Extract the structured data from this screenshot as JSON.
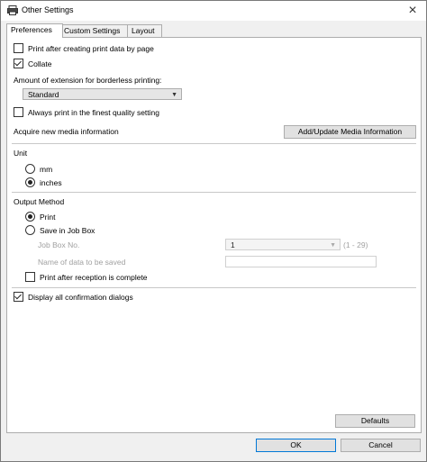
{
  "window": {
    "title": "Other Settings",
    "close_glyph": "×"
  },
  "tabs": [
    {
      "label": "Preferences",
      "active": true
    },
    {
      "label": "Custom Settings",
      "active": false
    },
    {
      "label": "Layout",
      "active": false
    }
  ],
  "preferences": {
    "print_after_creating": {
      "label": "Print after creating print data by page",
      "checked": false
    },
    "collate": {
      "label": "Collate",
      "checked": true
    },
    "borderless_label": "Amount of extension for borderless printing:",
    "borderless_value": "Standard",
    "finest_quality": {
      "label": "Always print in the finest quality setting",
      "checked": false
    },
    "acquire_media_label": "Acquire new media information",
    "add_update_media_button": "Add/Update Media Information",
    "unit": {
      "label": "Unit",
      "options": [
        {
          "label": "mm",
          "selected": false
        },
        {
          "label": "inches",
          "selected": true
        }
      ]
    },
    "output_method": {
      "label": "Output Method",
      "print": {
        "label": "Print",
        "selected": true
      },
      "save_in_job_box": {
        "label": "Save in Job Box",
        "selected": false
      },
      "job_box_no_label": "Job Box No.",
      "job_box_no_value": "1",
      "job_box_range": "(1 - 29)",
      "name_of_data_label": "Name of data to be saved",
      "name_of_data_value": "",
      "print_after_reception": {
        "label": "Print after reception is complete",
        "checked": false
      }
    },
    "display_confirmations": {
      "label": "Display all confirmation dialogs",
      "checked": true
    },
    "defaults_button": "Defaults"
  },
  "footer": {
    "ok_button": "OK",
    "cancel_button": "Cancel"
  }
}
